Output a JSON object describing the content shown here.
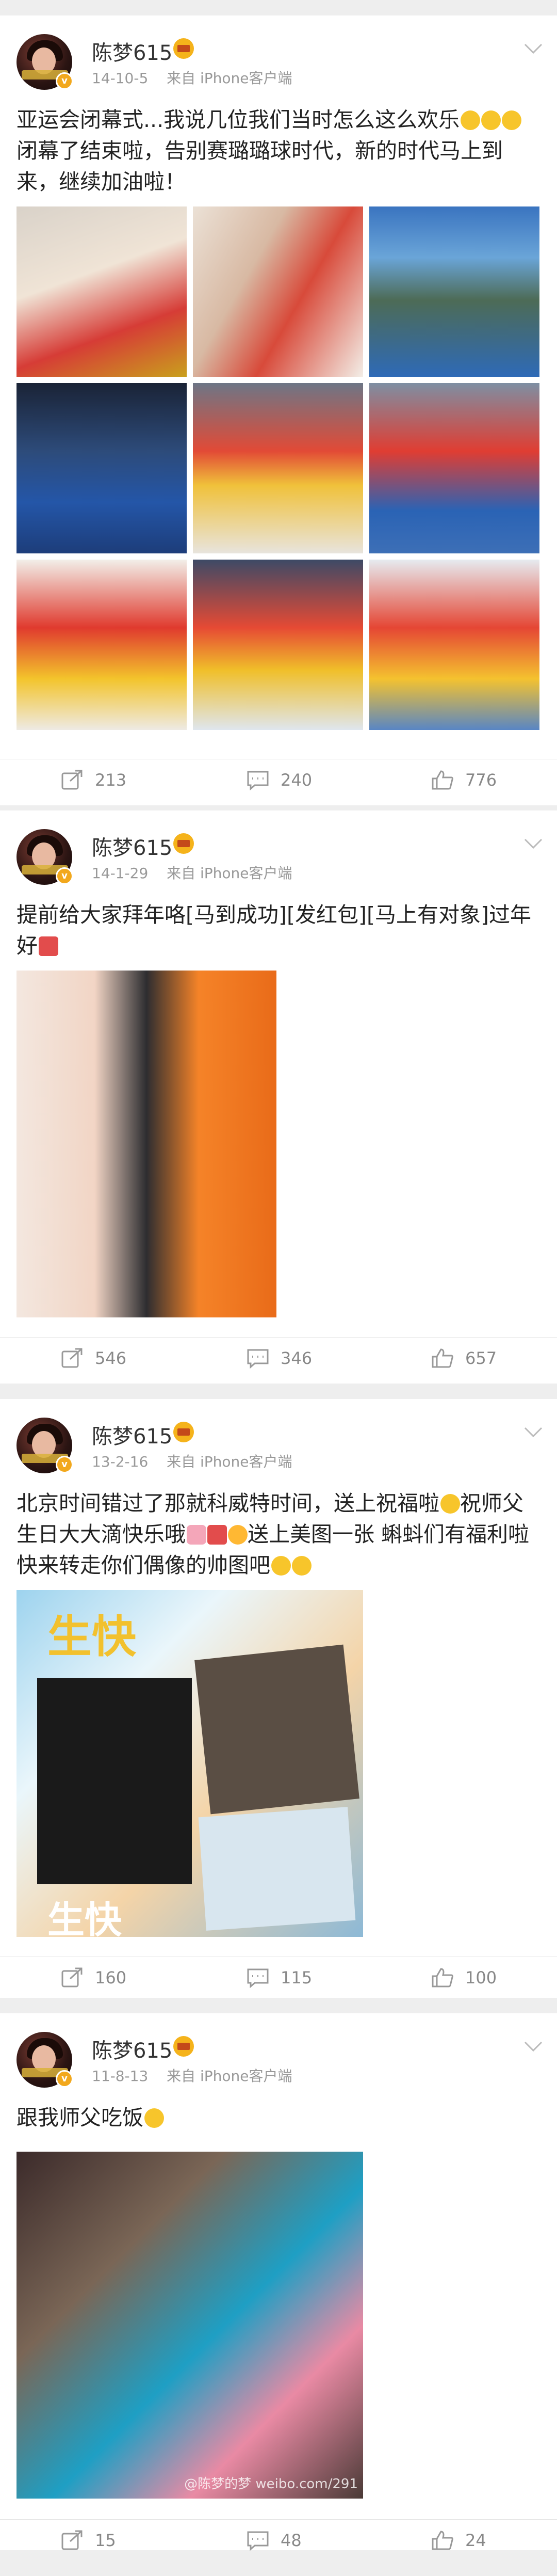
{
  "colors": {
    "background": "#eeeeee",
    "card": "#ffffff",
    "text": "#222222",
    "meta": "#999999",
    "action": "#888888"
  },
  "posts": [
    {
      "username": "陈梦615",
      "date": "14-10-5",
      "source": "来自 iPhone客户端",
      "text": "亚运会闭幕式...我说几位我们当时怎么这么欢乐",
      "text2": "闭幕了结束啦，告别赛璐璐球时代，新的时代马上到来，继续加油啦！",
      "reposts": "213",
      "comments": "240",
      "likes": "776"
    },
    {
      "username": "陈梦615",
      "date": "14-1-29",
      "source": "来自 iPhone客户端",
      "text": "提前给大家拜年咯[马到成功][发红包][马上有对象]过年好",
      "reposts": "546",
      "comments": "346",
      "likes": "657"
    },
    {
      "username": "陈梦615",
      "date": "13-2-16",
      "source": "来自 iPhone客户端",
      "text": "北京时间错过了那就科威特时间，送上祝福啦",
      "text2": "祝师父生日大大滴快乐哦",
      "text3": "送上美图一张 蝌蚪们有福利啦快来转走你们偶像的帅图吧",
      "reposts": "160",
      "comments": "115",
      "likes": "100"
    },
    {
      "username": "陈梦615",
      "date": "11-8-13",
      "source": "来自 iPhone客户端",
      "text": "跟我师父吃饭",
      "watermark": "@陈梦的梦 weibo.com/291",
      "reposts": "15",
      "comments": "48",
      "likes": "24"
    }
  ],
  "icons": [
    "avatar",
    "verified-badge-icon",
    "crown-icon",
    "chevron-down-icon",
    "repost-icon",
    "comment-icon",
    "like-icon"
  ],
  "photo3_text": {
    "top": "生快",
    "bottom": "生快"
  }
}
